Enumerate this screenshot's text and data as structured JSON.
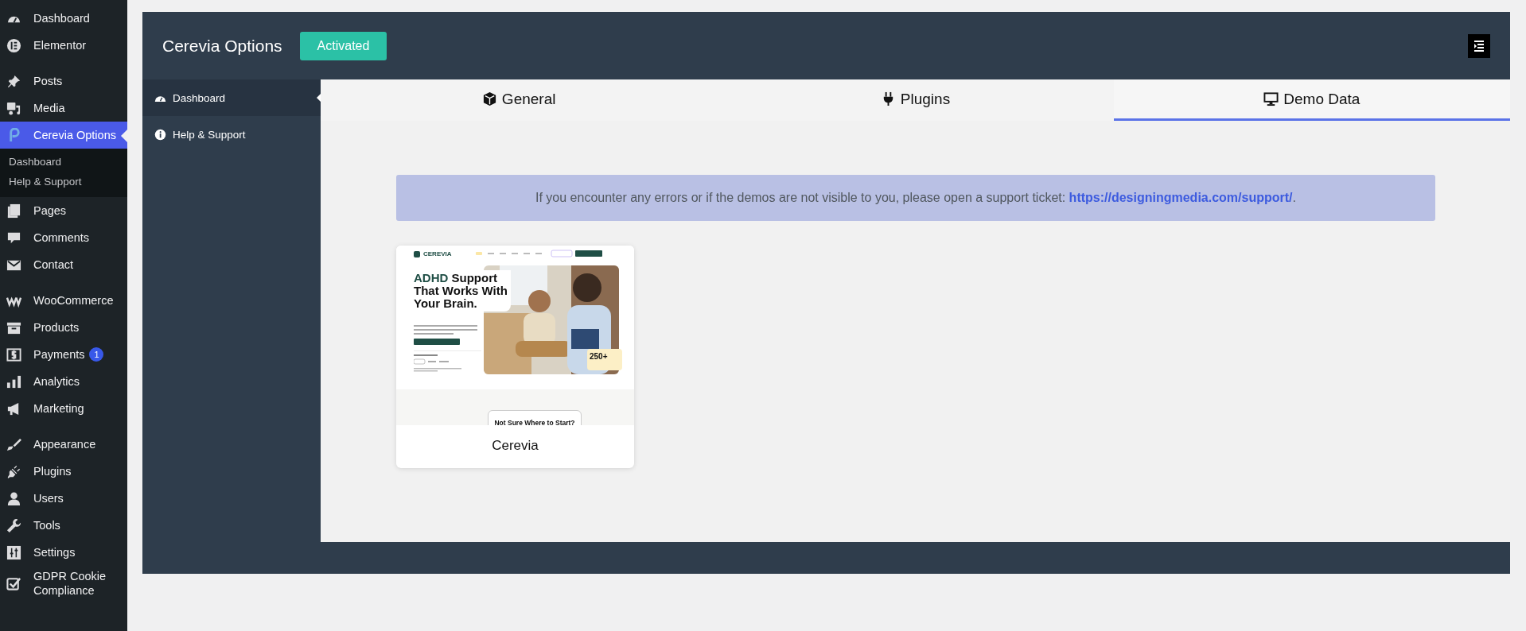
{
  "admin_menu": {
    "groups": [
      {
        "items": [
          {
            "label": "Dashboard",
            "selected": false
          },
          {
            "label": "Elementor",
            "selected": false
          }
        ]
      },
      {
        "items": [
          {
            "label": "Posts",
            "selected": false
          },
          {
            "label": "Media",
            "selected": false
          },
          {
            "label": "Cerevia Options",
            "selected": true,
            "submenu": [
              {
                "label": "Dashboard",
                "selected": false
              },
              {
                "label": "Help & Support",
                "selected": false
              }
            ]
          },
          {
            "label": "Pages",
            "selected": false
          },
          {
            "label": "Comments",
            "selected": false
          },
          {
            "label": "Contact",
            "selected": false
          }
        ]
      },
      {
        "items": [
          {
            "label": "WooCommerce",
            "selected": false
          },
          {
            "label": "Products",
            "selected": false
          },
          {
            "label": "Payments",
            "selected": false,
            "badge": "1"
          },
          {
            "label": "Analytics",
            "selected": false
          },
          {
            "label": "Marketing",
            "selected": false
          }
        ]
      },
      {
        "items": [
          {
            "label": "Appearance",
            "selected": false
          },
          {
            "label": "Plugins",
            "selected": false
          },
          {
            "label": "Users",
            "selected": false
          },
          {
            "label": "Tools",
            "selected": false
          },
          {
            "label": "Settings",
            "selected": false
          },
          {
            "label": "GDPR Cookie Compliance",
            "selected": false
          }
        ]
      }
    ]
  },
  "options_panel": {
    "title": "Cerevia Options",
    "status": "Activated",
    "nav": [
      {
        "label": "Dashboard",
        "selected": true
      },
      {
        "label": "Help & Support",
        "selected": false
      }
    ],
    "tabs": [
      {
        "label": "General",
        "selected": false
      },
      {
        "label": "Plugins",
        "selected": false
      },
      {
        "label": "Demo Data",
        "selected": true
      }
    ],
    "notice": {
      "text": "If you encounter any errors or if the demos are not visible to you, please open a support ticket: ",
      "link": "https://designingmedia.com/support/",
      "end": "."
    },
    "demos": [
      {
        "name": "Cerevia",
        "preview": {
          "brand": "CEREVIA",
          "headline_accent": "ADHD",
          "headline": "Support That Works With Your Brain.",
          "stat": "250+",
          "section_title": "Not Sure Where to Start?"
        }
      }
    ]
  }
}
